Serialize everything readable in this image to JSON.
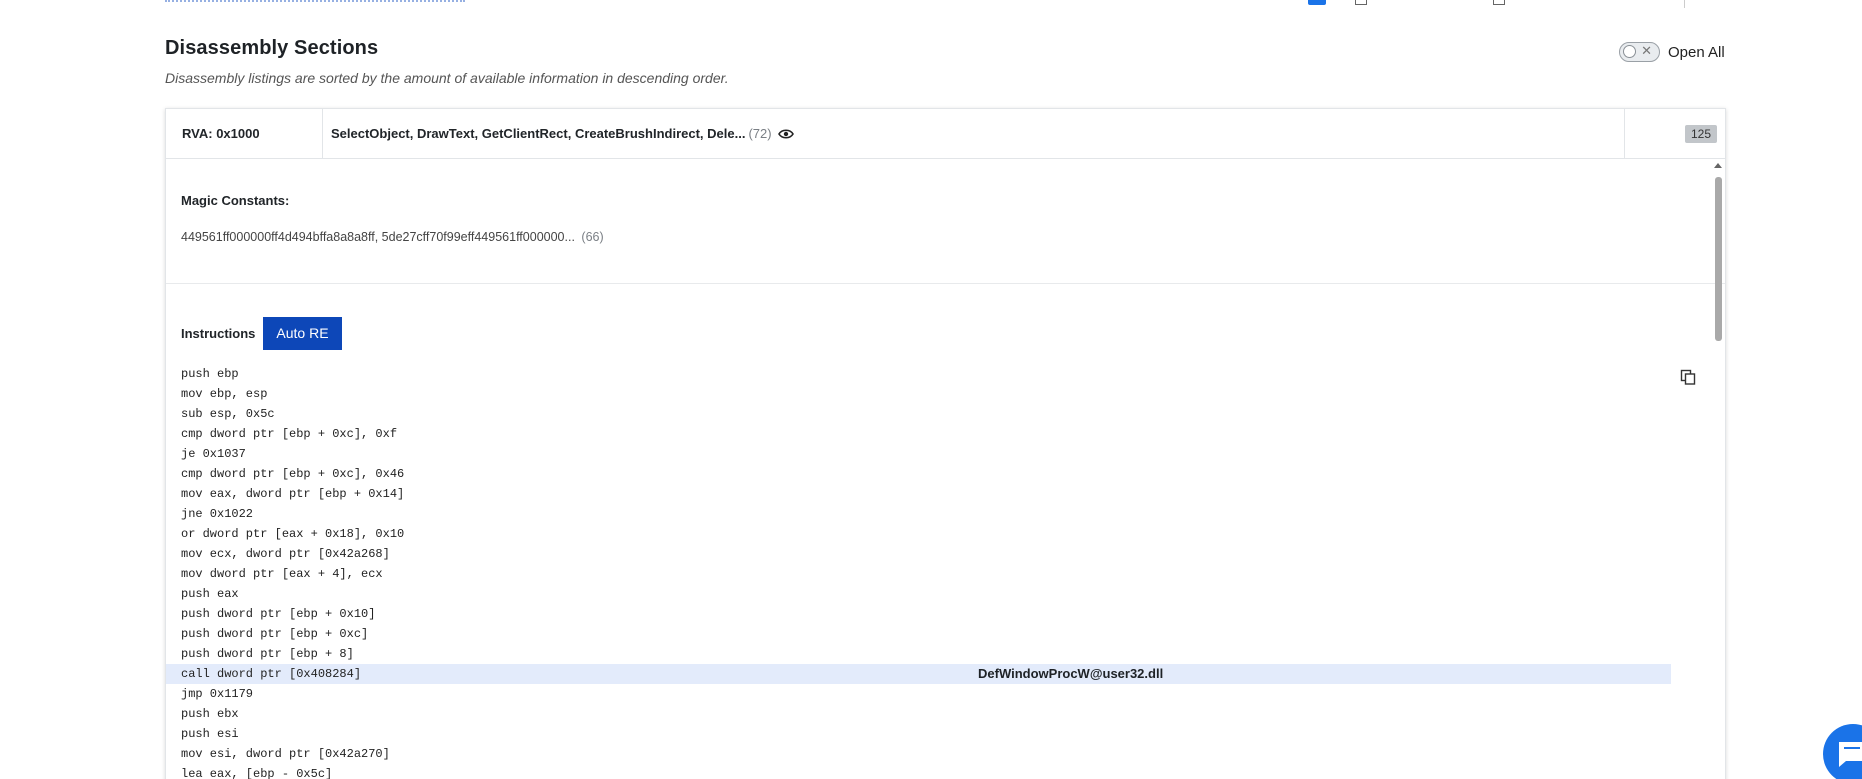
{
  "section": {
    "title": "Disassembly Sections",
    "subtitle": "Disassembly listings are sorted by the amount of available information in descending order.",
    "open_all_label": "Open All"
  },
  "card": {
    "rva": "RVA: 0x1000",
    "functions": "SelectObject, DrawText, GetClientRect, CreateBrushIndirect, Dele...",
    "functions_count": "(72)",
    "badge": "125",
    "magic_label": "Magic Constants:",
    "magic_value": "449561ff000000ff4d494bffa8a8a8ff, 5de27cff70f99eff449561ff000000...",
    "magic_count": "(66)",
    "instructions_label": "Instructions",
    "auto_re_label": "Auto RE"
  },
  "instructions": [
    {
      "text": "push ebp"
    },
    {
      "text": "mov ebp, esp"
    },
    {
      "text": "sub esp, 0x5c"
    },
    {
      "text": "cmp dword ptr [ebp + 0xc], 0xf"
    },
    {
      "text": "je 0x1037"
    },
    {
      "text": "cmp dword ptr [ebp + 0xc], 0x46"
    },
    {
      "text": "mov eax, dword ptr [ebp + 0x14]"
    },
    {
      "text": "jne 0x1022"
    },
    {
      "text": "or dword ptr [eax + 0x18], 0x10"
    },
    {
      "text": "mov ecx, dword ptr [0x42a268]"
    },
    {
      "text": "mov dword ptr [eax + 4], ecx"
    },
    {
      "text": "push eax"
    },
    {
      "text": "push dword ptr [ebp + 0x10]"
    },
    {
      "text": "push dword ptr [ebp + 0xc]"
    },
    {
      "text": "push dword ptr [ebp + 8]"
    },
    {
      "text": "call dword ptr [0x408284]",
      "annotation": "DefWindowProcW@user32.dll",
      "highlight": true
    },
    {
      "text": "jmp 0x1179"
    },
    {
      "text": "push ebx"
    },
    {
      "text": "push esi"
    },
    {
      "text": "mov esi, dword ptr [0x42a270]"
    },
    {
      "text": "lea eax, [ebp - 0x5c]"
    }
  ],
  "colors": {
    "accent": "#0d47b8",
    "highlight_row": "#e3ebfb",
    "chat_button": "#1a73e8"
  }
}
